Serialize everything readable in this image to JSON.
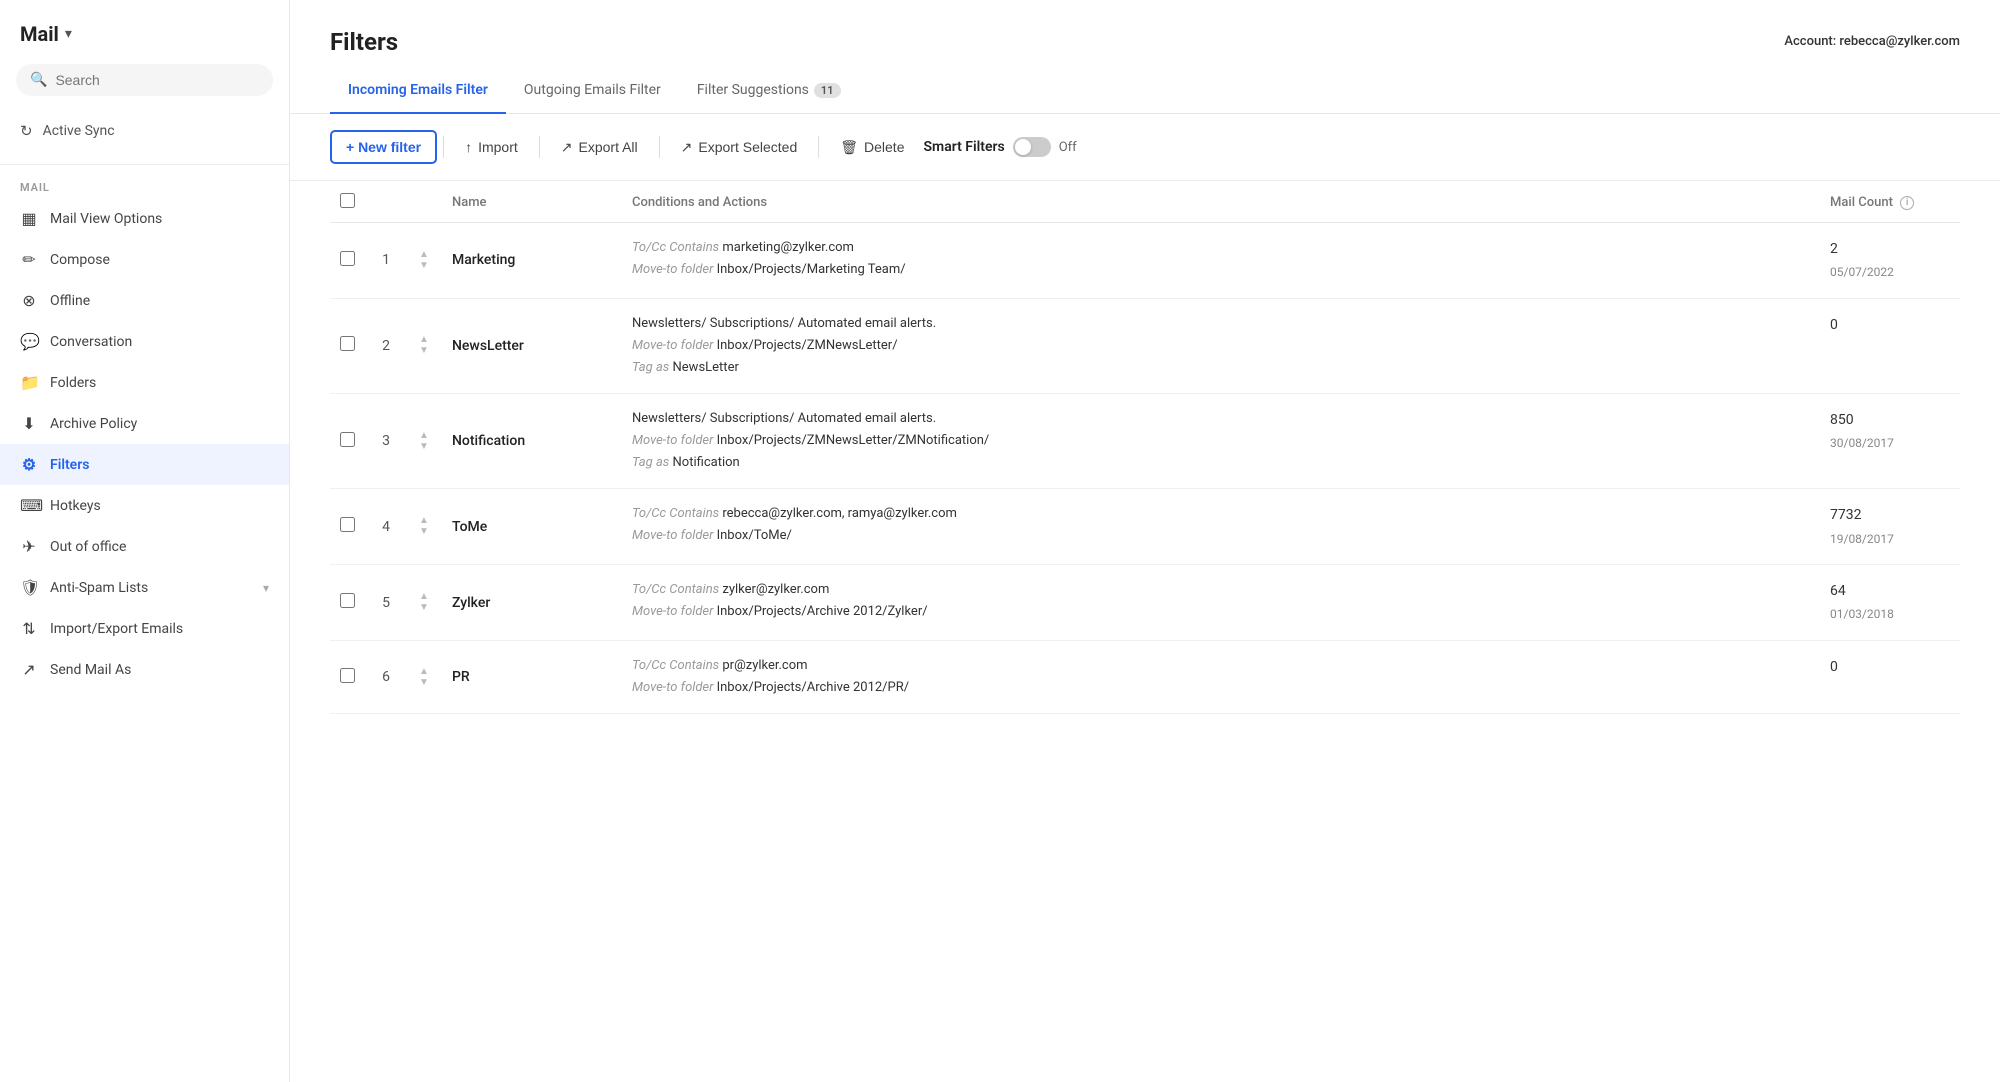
{
  "sidebar": {
    "title": "Mail",
    "search_placeholder": "Search",
    "sync_label": "Active Sync",
    "section_label": "MAIL",
    "items": [
      {
        "id": "mail-view-options",
        "icon": "▦",
        "label": "Mail View Options",
        "active": false
      },
      {
        "id": "compose",
        "icon": "✎",
        "label": "Compose",
        "active": false
      },
      {
        "id": "offline",
        "icon": "⊘",
        "label": "Offline",
        "active": false
      },
      {
        "id": "conversation",
        "icon": "✉",
        "label": "Conversation",
        "active": false
      },
      {
        "id": "folders",
        "icon": "▭",
        "label": "Folders",
        "active": false
      },
      {
        "id": "archive-policy",
        "icon": "↓",
        "label": "Archive Policy",
        "active": false
      },
      {
        "id": "filters",
        "icon": "⚗",
        "label": "Filters",
        "active": true
      },
      {
        "id": "hotkeys",
        "icon": "⌨",
        "label": "Hotkeys",
        "active": false
      },
      {
        "id": "out-of-office",
        "icon": "✈",
        "label": "Out of office",
        "active": false
      },
      {
        "id": "anti-spam",
        "icon": "⛨",
        "label": "Anti-Spam Lists",
        "active": false,
        "hasArrow": true
      },
      {
        "id": "import-export",
        "icon": "↑↓",
        "label": "Import/Export Emails",
        "active": false
      },
      {
        "id": "send-mail-as",
        "icon": "↗",
        "label": "Send Mail As",
        "active": false
      }
    ]
  },
  "header": {
    "title": "Filters",
    "account_label": "Account:",
    "account_email": "rebecca@zylker.com"
  },
  "tabs": [
    {
      "id": "incoming",
      "label": "Incoming Emails Filter",
      "active": true,
      "badge": null
    },
    {
      "id": "outgoing",
      "label": "Outgoing Emails Filter",
      "active": false,
      "badge": null
    },
    {
      "id": "suggestions",
      "label": "Filter Suggestions",
      "active": false,
      "badge": "11"
    }
  ],
  "toolbar": {
    "new_filter_label": "+ New filter",
    "import_label": "Import",
    "export_all_label": "Export All",
    "export_selected_label": "Export Selected",
    "delete_label": "Delete",
    "smart_filters_label": "Smart Filters",
    "toggle_state": "Off"
  },
  "table": {
    "columns": {
      "name": "Name",
      "conditions": "Conditions and Actions",
      "mail_count": "Mail Count"
    },
    "rows": [
      {
        "num": 1,
        "name": "Marketing",
        "conditions": [
          {
            "label": "To/Cc Contains",
            "value": "marketing@zylker.com"
          },
          {
            "label": "Move-to folder",
            "value": "Inbox/Projects/Marketing Team/"
          }
        ],
        "mail_count": "2",
        "mail_date": "05/07/2022"
      },
      {
        "num": 2,
        "name": "NewsLetter",
        "conditions": [
          {
            "label": "",
            "value": "Newsletters/ Subscriptions/ Automated email alerts."
          },
          {
            "label": "Move-to folder",
            "value": "Inbox/Projects/ZMNewsLetter/"
          },
          {
            "label": "Tag as",
            "value": "NewsLetter"
          }
        ],
        "mail_count": "0",
        "mail_date": ""
      },
      {
        "num": 3,
        "name": "Notification",
        "conditions": [
          {
            "label": "",
            "value": "Newsletters/ Subscriptions/ Automated email alerts."
          },
          {
            "label": "Move-to folder",
            "value": "Inbox/Projects/ZMNewsLetter/ZMNotification/"
          },
          {
            "label": "Tag as",
            "value": "Notification"
          }
        ],
        "mail_count": "850",
        "mail_date": "30/08/2017"
      },
      {
        "num": 4,
        "name": "ToMe",
        "conditions": [
          {
            "label": "To/Cc Contains",
            "value": "rebecca@zylker.com, ramya@zylker.com"
          },
          {
            "label": "Move-to folder",
            "value": "Inbox/ToMe/"
          }
        ],
        "mail_count": "7732",
        "mail_date": "19/08/2017"
      },
      {
        "num": 5,
        "name": "Zylker",
        "conditions": [
          {
            "label": "To/Cc Contains",
            "value": "zylker@zylker.com"
          },
          {
            "label": "Move-to folder",
            "value": "Inbox/Projects/Archive 2012/Zylker/"
          }
        ],
        "mail_count": "64",
        "mail_date": "01/03/2018"
      },
      {
        "num": 6,
        "name": "PR",
        "conditions": [
          {
            "label": "To/Cc Contains",
            "value": "pr@zylker.com"
          },
          {
            "label": "Move-to folder",
            "value": "Inbox/Projects/Archive 2012/PR/"
          }
        ],
        "mail_count": "0",
        "mail_date": ""
      }
    ]
  }
}
